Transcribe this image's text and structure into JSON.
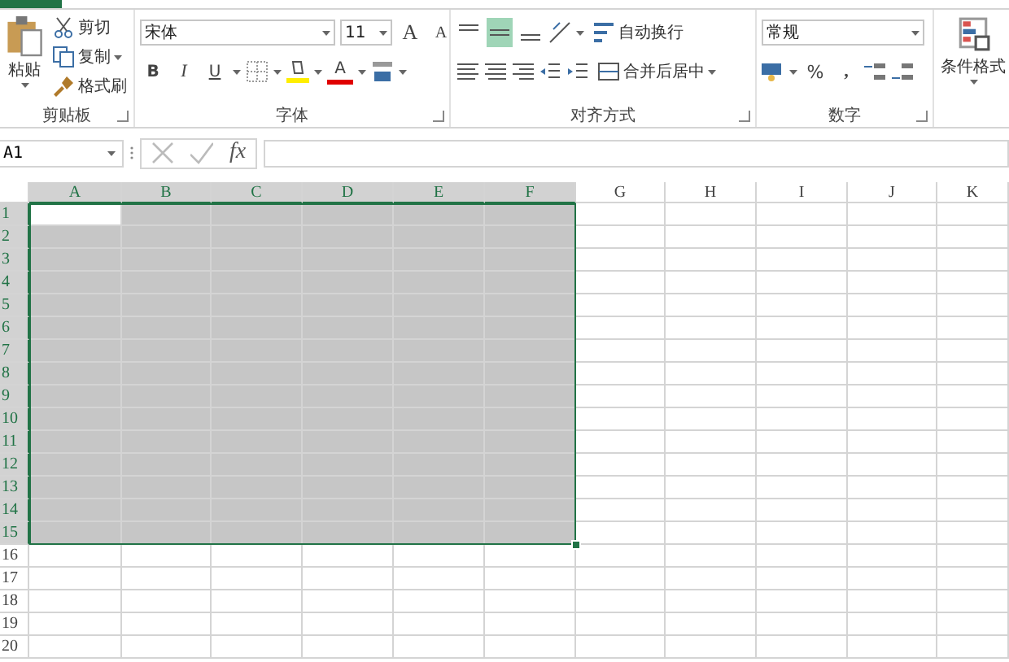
{
  "clipboard": {
    "label": "剪贴板",
    "paste": "粘贴",
    "cut": "剪切",
    "copy": "复制",
    "format_painter": "格式刷"
  },
  "font": {
    "label": "字体",
    "name": "宋体",
    "size": "11",
    "grow": "A",
    "shrink": "A",
    "bold": "B",
    "italic": "I",
    "underline": "U",
    "font_color": "A"
  },
  "alignment": {
    "label": "对齐方式",
    "vertical": [
      {
        "kind": "top",
        "selected": false
      },
      {
        "kind": "middle",
        "selected": true
      },
      {
        "kind": "bottom",
        "selected": false
      }
    ],
    "wrap_text": "自动换行",
    "merge_center": "合并后居中"
  },
  "number": {
    "label": "数字",
    "format": "常规",
    "percent": "%",
    "comma": ","
  },
  "styles": {
    "conditional_formatting": "条件格式"
  },
  "formula_bar": {
    "name_box": "A1",
    "fx": "fx"
  },
  "columns": [
    {
      "label": "A",
      "selected": true
    },
    {
      "label": "B",
      "selected": true
    },
    {
      "label": "C",
      "selected": true
    },
    {
      "label": "D",
      "selected": true
    },
    {
      "label": "E",
      "selected": true
    },
    {
      "label": "F",
      "selected": true
    },
    {
      "label": "G",
      "selected": false
    },
    {
      "label": "H",
      "selected": false
    },
    {
      "label": "I",
      "selected": false
    },
    {
      "label": "J",
      "selected": false
    },
    {
      "label": "K",
      "selected": false
    }
  ],
  "rows": [
    {
      "label": "1",
      "selected": true
    },
    {
      "label": "2",
      "selected": true
    },
    {
      "label": "3",
      "selected": true
    },
    {
      "label": "4",
      "selected": true
    },
    {
      "label": "5",
      "selected": true
    },
    {
      "label": "6",
      "selected": true
    },
    {
      "label": "7",
      "selected": true
    },
    {
      "label": "8",
      "selected": true
    },
    {
      "label": "9",
      "selected": true
    },
    {
      "label": "10",
      "selected": true
    },
    {
      "label": "11",
      "selected": true
    },
    {
      "label": "12",
      "selected": true
    },
    {
      "label": "13",
      "selected": true
    },
    {
      "label": "14",
      "selected": true
    },
    {
      "label": "15",
      "selected": true
    },
    {
      "label": "16",
      "selected": false
    },
    {
      "label": "17",
      "selected": false
    },
    {
      "label": "18",
      "selected": false
    },
    {
      "label": "19",
      "selected": false
    },
    {
      "label": "20",
      "selected": false
    }
  ]
}
